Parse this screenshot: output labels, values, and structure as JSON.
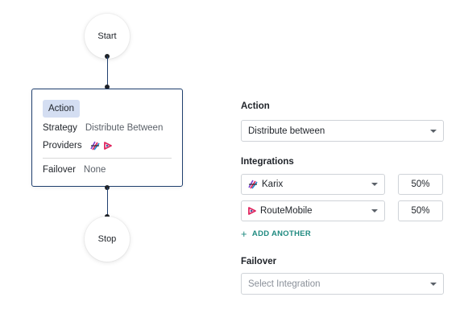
{
  "flow": {
    "start_label": "Start",
    "stop_label": "Stop",
    "action_card": {
      "chip_label": "Action",
      "strategy_label": "Strategy",
      "strategy_value": "Distribute Between",
      "providers_label": "Providers",
      "provider_icons": [
        "karix-icon",
        "routemobile-icon"
      ],
      "failover_label": "Failover",
      "failover_value": "None"
    }
  },
  "panel": {
    "action": {
      "label": "Action",
      "selected": "Distribute between"
    },
    "integrations": {
      "label": "Integrations",
      "items": [
        {
          "name": "Karix",
          "icon": "karix-icon",
          "percent": "50%"
        },
        {
          "name": "RouteMobile",
          "icon": "routemobile-icon",
          "percent": "50%"
        }
      ],
      "add_label": "ADD ANOTHER"
    },
    "failover": {
      "label": "Failover",
      "placeholder": "Select Integration"
    }
  },
  "colors": {
    "connector": "#1f3f6e",
    "chip_bg": "#d4def2",
    "accent": "#1f8a80",
    "routemobile_red": "#e0245e",
    "routemobile_blue": "#2d3a8c"
  }
}
